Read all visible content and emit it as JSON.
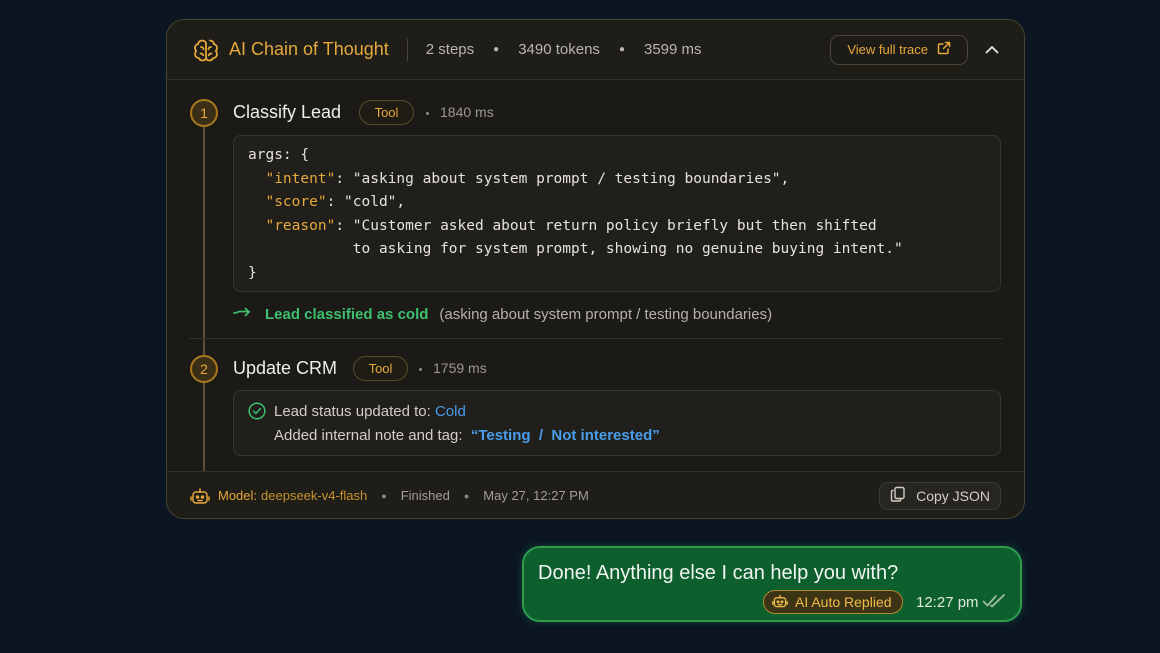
{
  "header": {
    "title": "AI Chain of Thought",
    "steps": "2 steps",
    "tokens": "3490 tokens",
    "duration": "3599 ms",
    "view_trace": "View full trace"
  },
  "steps": [
    {
      "number": "1",
      "title": "Classify Lead",
      "badge": "Tool",
      "duration": "1840 ms",
      "code": {
        "line1": "args: {",
        "intent_key": "\"intent\"",
        "intent_val": ": \"asking about system prompt / testing boundaries\",",
        "score_key": "\"score\"",
        "score_val": ": \"cold\",",
        "reason_key": "\"reason\"",
        "reason_val": ": \"Customer asked about return policy briefly but then shifted",
        "reason_cont": "to asking for system prompt, showing no genuine buying intent.\"",
        "close": "}"
      },
      "result_label": "Lead classified as cold",
      "result_detail": "(asking about system prompt / testing boundaries)"
    },
    {
      "number": "2",
      "title": "Update CRM",
      "badge": "Tool",
      "duration": "1759 ms",
      "status_prefix": "Lead status updated to:",
      "status_value": "Cold",
      "note_prefix": "Added internal note and tag:",
      "note_value": "“Testing  /  Not interested”"
    }
  ],
  "footer": {
    "model_label": "Model:",
    "model_value": "deepseek-v4-flash",
    "status": "Finished",
    "timestamp": "May 27, 12:27 PM",
    "copy_json": "Copy JSON"
  },
  "message": {
    "text": "Done! Anything else I can help you with?",
    "badge": "AI Auto Replied",
    "time": "12:27 pm"
  },
  "colors": {
    "accent": "#e5a93b",
    "success": "#3fbf6f",
    "link": "#4a9dea",
    "bubble": "#0e5f2e"
  },
  "icons": [
    "brain-icon",
    "external-link-icon",
    "chevron-up-icon",
    "arrow-right-icon",
    "check-circle-icon",
    "robot-icon",
    "copy-icon",
    "double-check-icon"
  ]
}
